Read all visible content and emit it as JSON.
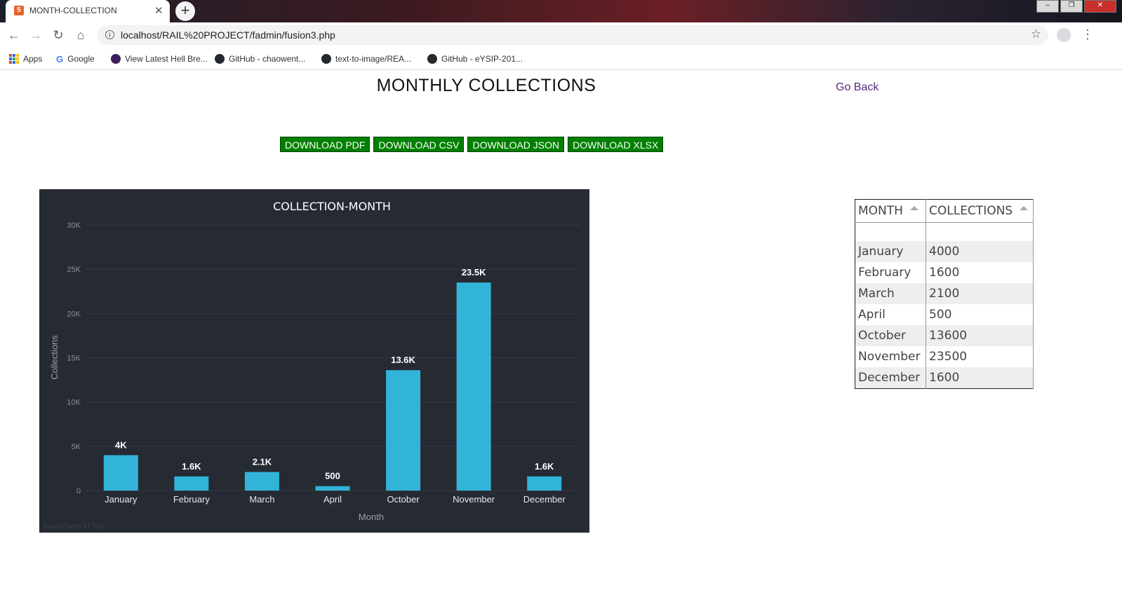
{
  "browser": {
    "tab_title": "MONTH-COLLECTION",
    "url": "localhost/RAIL%20PROJECT/fadmin/fusion3.php",
    "bookmarks": [
      {
        "label": "Apps"
      },
      {
        "label": "Google"
      },
      {
        "label": "View Latest Hell Bre..."
      },
      {
        "label": "GitHub - chaowent..."
      },
      {
        "label": "text-to-image/REA..."
      },
      {
        "label": "GitHub - eYSIP-201..."
      }
    ]
  },
  "page": {
    "title": "MONTHLY COLLECTIONS",
    "go_back": "Go Back",
    "downloads": [
      "DOWNLOAD PDF",
      "DOWNLOAD CSV",
      "DOWNLOAD JSON",
      "DOWNLOAD XLSX"
    ]
  },
  "colors": {
    "chart_bg": "#262a33",
    "bar": "#32b4d9",
    "button_green": "#008000",
    "link": "#5b2a86"
  },
  "chart_data": {
    "type": "bar",
    "title": "COLLECTION-MONTH",
    "xlabel": "Month",
    "ylabel": "Collections",
    "categories": [
      "January",
      "February",
      "March",
      "April",
      "October",
      "November",
      "December"
    ],
    "values": [
      4000,
      1600,
      2100,
      500,
      13600,
      23500,
      1600
    ],
    "value_labels": [
      "4K",
      "1.6K",
      "2.1K",
      "500",
      "13.6K",
      "23.5K",
      "1.6K"
    ],
    "ylim": [
      0,
      30000
    ],
    "yticks": [
      0,
      5000,
      10000,
      15000,
      20000,
      25000,
      30000
    ],
    "ytick_labels": [
      "0",
      "5K",
      "10K",
      "15K",
      "20K",
      "25K",
      "30K"
    ],
    "grid": true,
    "watermark": "FusionCharts XT Trial"
  },
  "table": {
    "headers": [
      "MONTH",
      "COLLECTIONS"
    ],
    "rows": [
      [
        "January",
        "4000"
      ],
      [
        "February",
        "1600"
      ],
      [
        "March",
        "2100"
      ],
      [
        "April",
        "500"
      ],
      [
        "October",
        "13600"
      ],
      [
        "November",
        "23500"
      ],
      [
        "December",
        "1600"
      ]
    ]
  }
}
